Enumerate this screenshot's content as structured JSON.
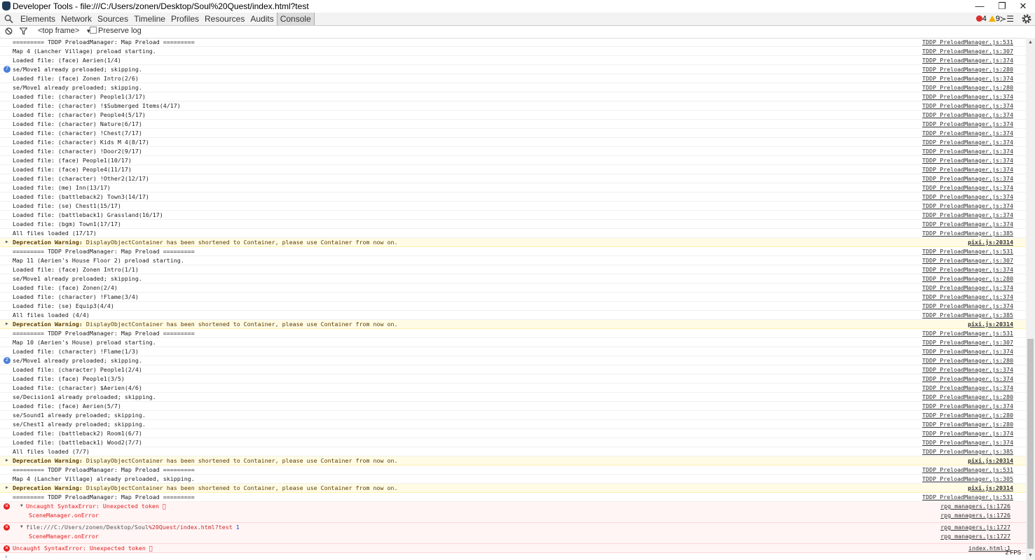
{
  "window": {
    "title": "Developer Tools - file:///C:/Users/zonen/Desktop/Soul%20Quest/index.html?test",
    "minimize": "—",
    "restore": "❐",
    "close": "✕"
  },
  "toolbar": {
    "tabs": [
      "Elements",
      "Network",
      "Sources",
      "Timeline",
      "Profiles",
      "Resources",
      "Audits",
      "Console"
    ],
    "selected_tab": "Console",
    "error_count": "4",
    "warning_count": "9",
    "drawer_glyph": "≻☰"
  },
  "filterbar": {
    "frame_label": "<top frame>",
    "frame_arrow": "▼",
    "preserve_log_label": "Preserve log"
  },
  "colors": {
    "error": "#e02020",
    "warning_bg": "#fffbe5",
    "repeat_badge": "#4b7fd6",
    "selected_tab_bg": "#dcdcdc"
  },
  "console": {
    "rows": [
      {
        "type": "log",
        "text": "========= TDDP PreloadManager: Map Preload =========",
        "src": "TDDP PreloadManager.js:531"
      },
      {
        "type": "log",
        "text": "Map 4 (Lancher Village) preload starting.",
        "src": "TDDP PreloadManager.js:307"
      },
      {
        "type": "log",
        "text": "Loaded file: (face) Aerien(1/4)",
        "src": "TDDP PreloadManager.js:374"
      },
      {
        "type": "log",
        "text": "se/Move1 already preloaded; skipping.",
        "src": "TDDP PreloadManager.js:280",
        "count": "7"
      },
      {
        "type": "log",
        "text": "Loaded file: (face) Zonen Intro(2/6)",
        "src": "TDDP PreloadManager.js:374"
      },
      {
        "type": "log",
        "text": "se/Move1 already preloaded; skipping.",
        "src": "TDDP PreloadManager.js:280"
      },
      {
        "type": "log",
        "text": "Loaded file: (character) People1(3/17)",
        "src": "TDDP PreloadManager.js:374"
      },
      {
        "type": "log",
        "text": "Loaded file: (character) !$Submerged Items(4/17)",
        "src": "TDDP PreloadManager.js:374"
      },
      {
        "type": "log",
        "text": "Loaded file: (character) People4(5/17)",
        "src": "TDDP PreloadManager.js:374"
      },
      {
        "type": "log",
        "text": "Loaded file: (character) Nature(6/17)",
        "src": "TDDP PreloadManager.js:374"
      },
      {
        "type": "log",
        "text": "Loaded file: (character) !Chest(7/17)",
        "src": "TDDP PreloadManager.js:374"
      },
      {
        "type": "log",
        "text": "Loaded file: (character) Kids M 4(8/17)",
        "src": "TDDP PreloadManager.js:374"
      },
      {
        "type": "log",
        "text": "Loaded file: (character) !Door2(9/17)",
        "src": "TDDP PreloadManager.js:374"
      },
      {
        "type": "log",
        "text": "Loaded file: (face) People1(10/17)",
        "src": "TDDP PreloadManager.js:374"
      },
      {
        "type": "log",
        "text": "Loaded file: (face) People4(11/17)",
        "src": "TDDP PreloadManager.js:374"
      },
      {
        "type": "log",
        "text": "Loaded file: (character) !Other2(12/17)",
        "src": "TDDP PreloadManager.js:374"
      },
      {
        "type": "log",
        "text": "Loaded file: (me) Inn(13/17)",
        "src": "TDDP PreloadManager.js:374"
      },
      {
        "type": "log",
        "text": "Loaded file: (battleback2) Town3(14/17)",
        "src": "TDDP PreloadManager.js:374"
      },
      {
        "type": "log",
        "text": "Loaded file: (se) Chest1(15/17)",
        "src": "TDDP PreloadManager.js:374"
      },
      {
        "type": "log",
        "text": "Loaded file: (battleback1) Grassland(16/17)",
        "src": "TDDP PreloadManager.js:374"
      },
      {
        "type": "log",
        "text": "Loaded file: (bgm) Town1(17/17)",
        "src": "TDDP PreloadManager.js:374"
      },
      {
        "type": "log",
        "text": "All files loaded (17/17)",
        "src": "TDDP PreloadManager.js:385"
      },
      {
        "type": "warning",
        "label": "Deprecation Warning:",
        "text": " DisplayObjectContainer has been shortened to Container, please use Container from now on.",
        "src": "pixi.js:20314"
      },
      {
        "type": "log",
        "text": "========= TDDP PreloadManager: Map Preload =========",
        "src": "TDDP PreloadManager.js:531"
      },
      {
        "type": "log",
        "text": "Map 11 (Aerien's House Floor 2) preload starting.",
        "src": "TDDP PreloadManager.js:307"
      },
      {
        "type": "log",
        "text": "Loaded file: (face) Zonen Intro(1/1)",
        "src": "TDDP PreloadManager.js:374"
      },
      {
        "type": "log",
        "text": "se/Move1 already preloaded; skipping.",
        "src": "TDDP PreloadManager.js:280"
      },
      {
        "type": "log",
        "text": "Loaded file: (face) Zonen(2/4)",
        "src": "TDDP PreloadManager.js:374"
      },
      {
        "type": "log",
        "text": "Loaded file: (character) !Flame(3/4)",
        "src": "TDDP PreloadManager.js:374"
      },
      {
        "type": "log",
        "text": "Loaded file: (se) Equip3(4/4)",
        "src": "TDDP PreloadManager.js:374"
      },
      {
        "type": "log",
        "text": "All files loaded (4/4)",
        "src": "TDDP PreloadManager.js:385"
      },
      {
        "type": "warning",
        "label": "Deprecation Warning:",
        "text": " DisplayObjectContainer has been shortened to Container, please use Container from now on.",
        "src": "pixi.js:20314"
      },
      {
        "type": "log",
        "text": "========= TDDP PreloadManager: Map Preload =========",
        "src": "TDDP PreloadManager.js:531"
      },
      {
        "type": "log",
        "text": "Map 10 (Aerien's House) preload starting.",
        "src": "TDDP PreloadManager.js:307"
      },
      {
        "type": "log",
        "text": "Loaded file: (character) !Flame(1/3)",
        "src": "TDDP PreloadManager.js:374"
      },
      {
        "type": "log",
        "text": "se/Move1 already preloaded; skipping.",
        "src": "TDDP PreloadManager.js:280",
        "count": "2"
      },
      {
        "type": "log",
        "text": "Loaded file: (character) People1(2/4)",
        "src": "TDDP PreloadManager.js:374"
      },
      {
        "type": "log",
        "text": "Loaded file: (face) People1(3/5)",
        "src": "TDDP PreloadManager.js:374"
      },
      {
        "type": "log",
        "text": "Loaded file: (character) $Aerien(4/6)",
        "src": "TDDP PreloadManager.js:374"
      },
      {
        "type": "log",
        "text": "se/Decision1 already preloaded; skipping.",
        "src": "TDDP PreloadManager.js:280"
      },
      {
        "type": "log",
        "text": "Loaded file: (face) Aerien(5/7)",
        "src": "TDDP PreloadManager.js:374"
      },
      {
        "type": "log",
        "text": "se/Sound1 already preloaded; skipping.",
        "src": "TDDP PreloadManager.js:280"
      },
      {
        "type": "log",
        "text": "se/Chest1 already preloaded; skipping.",
        "src": "TDDP PreloadManager.js:280"
      },
      {
        "type": "log",
        "text": "Loaded file: (battleback2) Room1(6/7)",
        "src": "TDDP PreloadManager.js:374"
      },
      {
        "type": "log",
        "text": "Loaded file: (battleback1) Wood2(7/7)",
        "src": "TDDP PreloadManager.js:374"
      },
      {
        "type": "log",
        "text": "All files loaded (7/7)",
        "src": "TDDP PreloadManager.js:385"
      },
      {
        "type": "warning",
        "label": "Deprecation Warning:",
        "text": " DisplayObjectContainer has been shortened to Container, please use Container from now on.",
        "src": "pixi.js:20314"
      },
      {
        "type": "log",
        "text": "========= TDDP PreloadManager: Map Preload =========",
        "src": "TDDP PreloadManager.js:531"
      },
      {
        "type": "log",
        "text": "Map 4 (Lancher Village) already preloaded, skipping.",
        "src": "TDDP PreloadManager.js:305"
      },
      {
        "type": "warning",
        "label": "Deprecation Warning:",
        "text": " DisplayObjectContainer has been shortened to Container, please use Container from now on.",
        "src": "pixi.js:20314"
      },
      {
        "type": "log",
        "text": "========= TDDP PreloadManager: Map Preload =========",
        "src": "TDDP PreloadManager.js:531"
      }
    ],
    "error1": {
      "text": "Uncaught SyntaxError: Unexpected token \u0000",
      "src": "rpg managers.js:1726",
      "sub": "SceneManager.onError",
      "subsrc": "rpg managers.js:1726"
    },
    "error2": {
      "path1": "file:///C:/Users/zonen/Desktop/Soul",
      "path2": "%20Quest/index.html?test",
      "num": "1",
      "src": "rpg managers.js:1727",
      "sub": "SceneManager.onError",
      "subsrc": "rpg managers.js:1727"
    },
    "error3": {
      "text": "Uncaught SyntaxError: Unexpected token \u0000",
      "src": "index.html:1"
    },
    "prompt": "›",
    "fps": "2 FPS"
  }
}
